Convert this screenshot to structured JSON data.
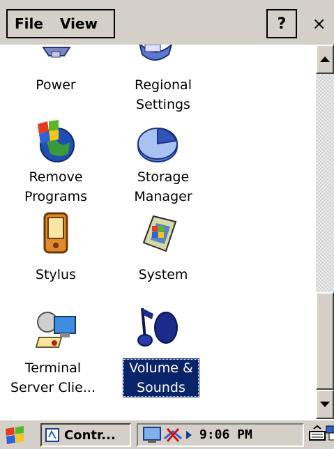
{
  "menu": {
    "file_label": "File",
    "view_label": "View",
    "help_label": "?",
    "close_label": "×"
  },
  "items": [
    {
      "label_lines": [
        "Power"
      ],
      "icon": "power-icon"
    },
    {
      "label_lines": [
        "Regional",
        "Settings"
      ],
      "icon": "regional-settings-icon"
    },
    {
      "label_lines": [
        "Remove",
        "Programs"
      ],
      "icon": "remove-programs-icon"
    },
    {
      "label_lines": [
        "Storage",
        "Manager"
      ],
      "icon": "storage-manager-icon"
    },
    {
      "label_lines": [
        "Stylus"
      ],
      "icon": "stylus-icon"
    },
    {
      "label_lines": [
        "System"
      ],
      "icon": "system-icon"
    },
    {
      "label_lines": [
        "Terminal",
        "Server Clie..."
      ],
      "icon": "terminal-server-icon"
    },
    {
      "label_lines": [
        "Volume &",
        "Sounds"
      ],
      "icon": "volume-sounds-icon",
      "selected": true
    }
  ],
  "taskbar": {
    "task_label": "Contr...",
    "clock": "9:06 PM",
    "icons": [
      "start-icon",
      "control-panel-icon",
      "network-icon",
      "disconnected-icon",
      "tray-arrow-icon",
      "keyboard-icon",
      "desktop-switch-icon"
    ]
  },
  "colors": {
    "chrome": "#d4d0c8",
    "selection": "#0a246a"
  }
}
